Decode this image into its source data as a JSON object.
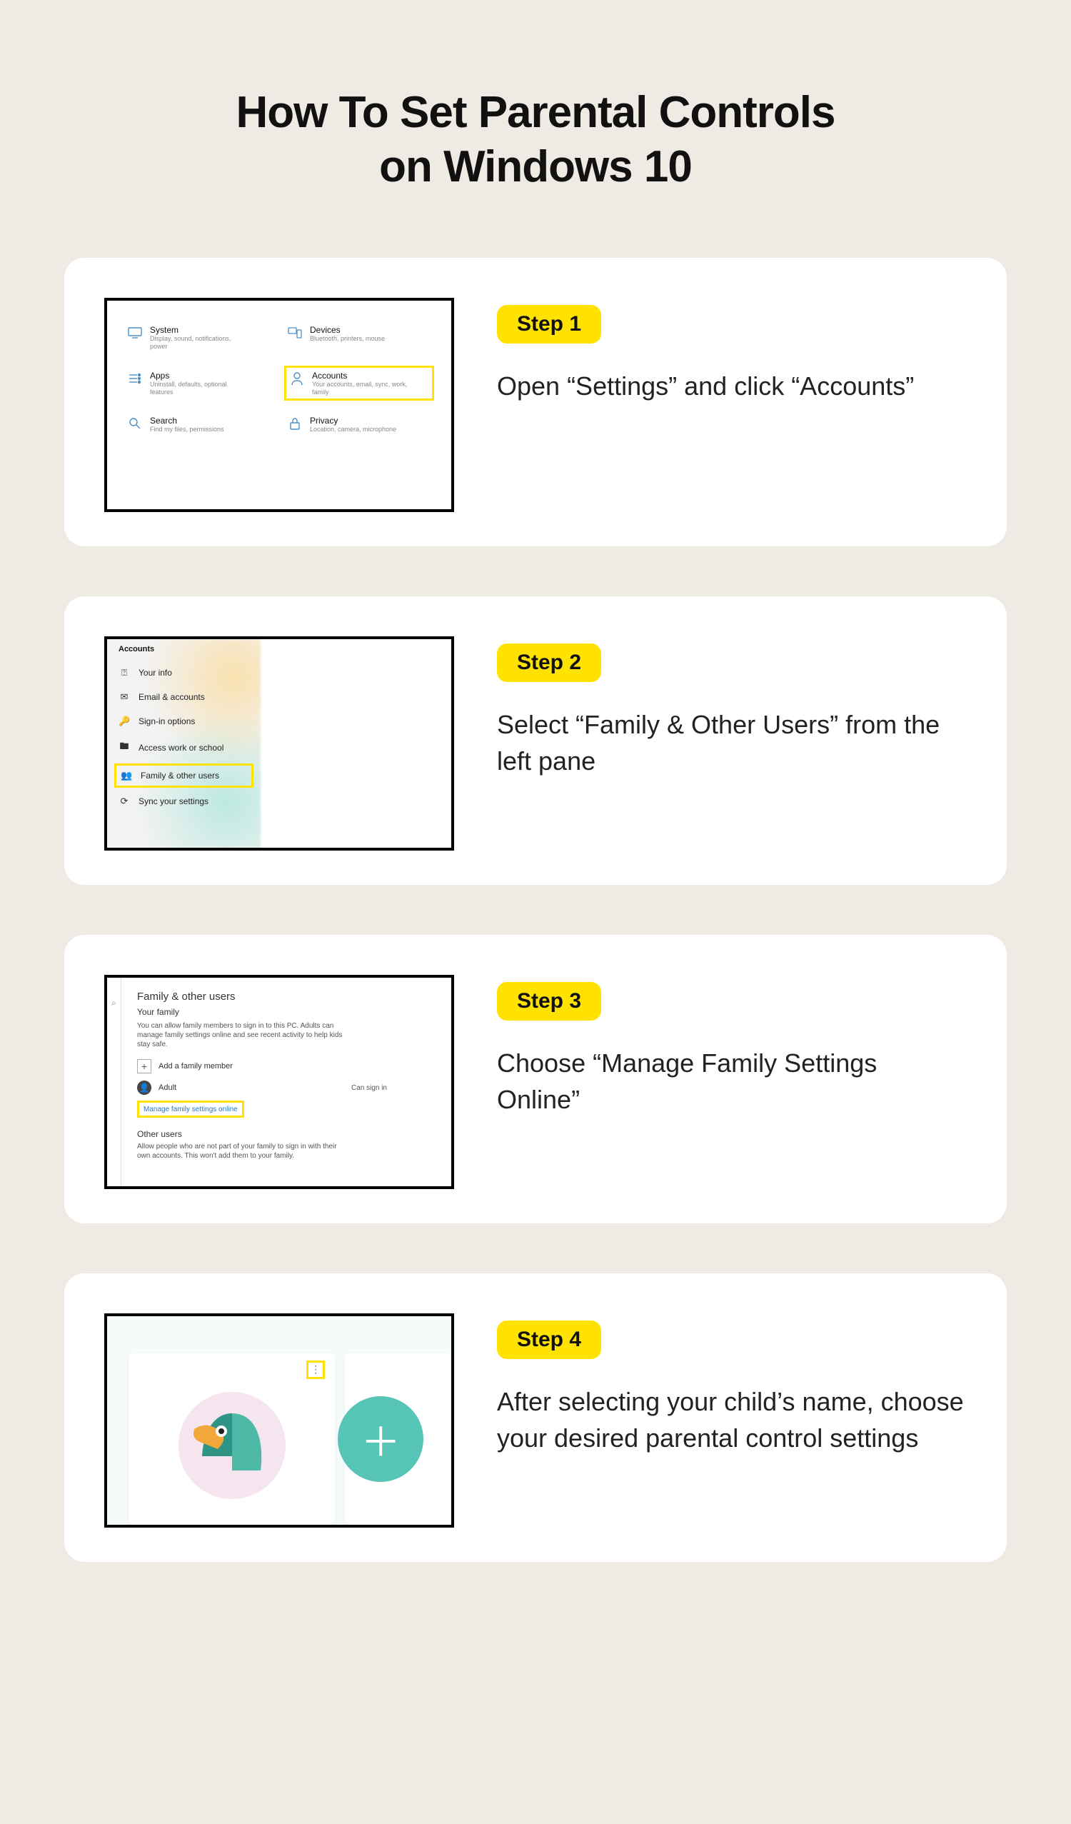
{
  "title_line1": "How To Set Parental Controls",
  "title_line2": "on Windows 10",
  "steps": [
    {
      "badge": "Step 1",
      "desc": "Open “Settings” and click “Accounts”"
    },
    {
      "badge": "Step 2",
      "desc": "Select “Family & Other Users” from the left pane"
    },
    {
      "badge": "Step 3",
      "desc": "Choose “Manage Family Settings Online”"
    },
    {
      "badge": "Step 4",
      "desc": "After selecting your child’s name, choose your desired parental control settings"
    }
  ],
  "settings_tiles": {
    "system": {
      "label": "System",
      "sub": "Display, sound, notifications, power"
    },
    "devices": {
      "label": "Devices",
      "sub": "Bluetooth, printers, mouse"
    },
    "apps": {
      "label": "Apps",
      "sub": "Uninstall, defaults, optional features"
    },
    "accounts": {
      "label": "Accounts",
      "sub": "Your accounts, email, sync, work, family"
    },
    "search": {
      "label": "Search",
      "sub": "Find my files, permissions"
    },
    "privacy": {
      "label": "Privacy",
      "sub": "Location, camera, microphone"
    }
  },
  "accounts_sidebar": {
    "header": "Accounts",
    "items": [
      "Your info",
      "Email & accounts",
      "Sign-in options",
      "Access work or school",
      "Family & other users",
      "Sync your settings"
    ]
  },
  "family_panel": {
    "title": "Family & other users",
    "your_family": "Your family",
    "family_para": "You can allow family members to sign in to this PC. Adults can manage family settings online and see recent activity to help kids stay safe.",
    "add_member": "Add a family member",
    "adult_label": "Adult",
    "can_sign_in": "Can sign in",
    "manage_link": "Manage family settings online",
    "other_users": "Other users",
    "other_para": "Allow people who are not part of your family to sign in with their own accounts. This won't add them to your family."
  },
  "colors": {
    "badge_bg": "#ffe200",
    "highlight": "#ffe200",
    "link": "#2976c6"
  }
}
